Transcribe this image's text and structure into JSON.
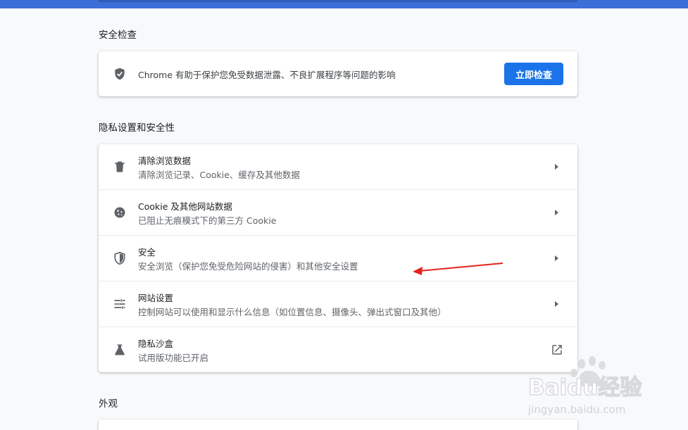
{
  "colors": {
    "accent": "#1a73e8",
    "topbar": "#3b6ed6",
    "icon": "#5f6368",
    "annotation": "#e3241b"
  },
  "safety_check": {
    "section_title": "安全检查",
    "icon": "shield-check-icon",
    "description": "Chrome 有助于保护您免受数据泄露、不良扩展程序等问题的影响",
    "button_label": "立即检查"
  },
  "privacy": {
    "section_title": "隐私设置和安全性",
    "items": [
      {
        "icon": "trash-icon",
        "title": "清除浏览数据",
        "subtitle": "清除浏览记录、Cookie、缓存及其他数据",
        "action": "chevron-right-icon"
      },
      {
        "icon": "cookie-icon",
        "title": "Cookie 及其他网站数据",
        "subtitle": "已阻止无痕模式下的第三方 Cookie",
        "action": "chevron-right-icon"
      },
      {
        "icon": "shield-icon",
        "title": "安全",
        "subtitle": "安全浏览（保护您免受危险网站的侵害）和其他安全设置",
        "action": "chevron-right-icon"
      },
      {
        "icon": "tune-icon",
        "title": "网站设置",
        "subtitle": "控制网站可以使用和显示什么信息（如位置信息、摄像头、弹出式窗口及其他）",
        "action": "chevron-right-icon"
      },
      {
        "icon": "flask-icon",
        "title": "隐私沙盒",
        "subtitle": "试用版功能已开启",
        "action": "external-link-icon"
      }
    ]
  },
  "appearance": {
    "section_title": "外观"
  },
  "watermark": {
    "brand": "Baidu经验",
    "url": "jingyan.baidu.com"
  }
}
